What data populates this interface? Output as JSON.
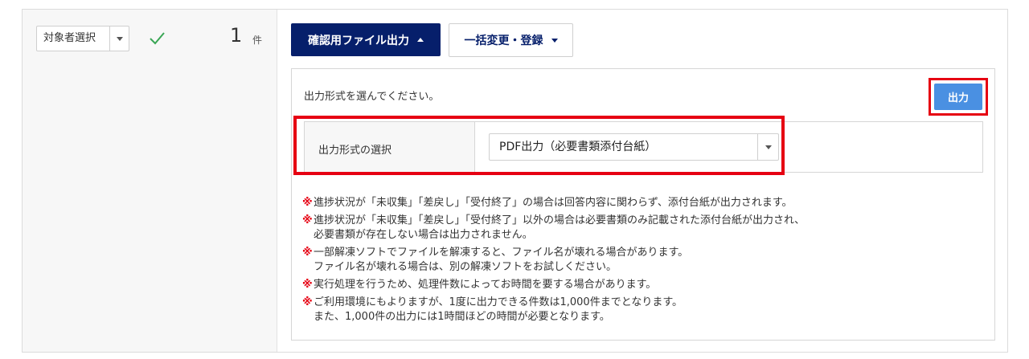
{
  "row": {
    "target_select_label": "対象者選択",
    "count": "1",
    "count_unit": "件"
  },
  "toolbar": {
    "confirm_file_label": "確認用ファイル出力",
    "bulk_change_label": "一括変更・登録"
  },
  "panel": {
    "message": "出力形式を選んでください。",
    "output_button_label": "出力",
    "format_label": "出力形式の選択",
    "format_value": "PDF出力（必要書類添付台紙）"
  },
  "notes": {
    "mark": "※",
    "items": [
      "進捗状況が「未収集」「差戻し」「受付終了」の場合は回答内容に関わらず、添付台紙が出力されます。",
      "進捗状況が「未収集」「差戻し」「受付終了」以外の場合は必要書類のみ記載された添付台紙が出力され、\n必要書類が存在しない場合は出力されません。",
      "一部解凍ソフトでファイルを解凍すると、ファイル名が壊れる場合があります。\nファイル名が壊れる場合は、別の解凍ソフトをお試しください。",
      "実行処理を行うため、処理件数によってお時間を要する場合があります。",
      "ご利用環境にもよりますが、1度に出力できる件数は1,000件までとなります。\nまた、1,000件の出力には1時間ほどの時間が必要となります。"
    ]
  },
  "colors": {
    "navy": "#061f6b",
    "output_blue": "#4a90e2",
    "highlight_red": "#e60012",
    "check_green": "#3aa655"
  },
  "icons": {
    "check": "check-icon",
    "dropdown": "chevron-down-icon",
    "dropup": "chevron-up-icon"
  }
}
